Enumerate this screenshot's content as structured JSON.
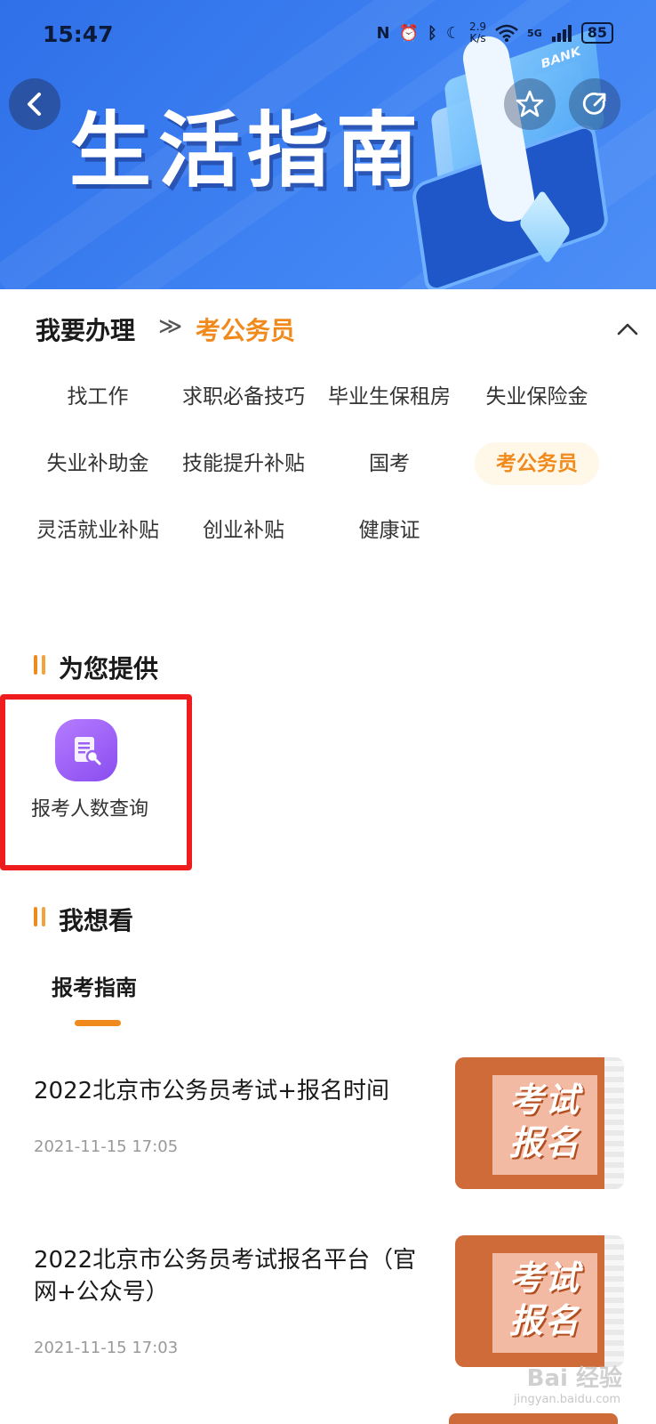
{
  "status_bar": {
    "time": "15:47",
    "net_speed_value": "2.9",
    "net_speed_unit": "K/s",
    "network": "5G",
    "battery": "85"
  },
  "banner": {
    "title": "生活指南",
    "card_text": "BANK"
  },
  "handle": {
    "title": "我要办理",
    "separator": "≫",
    "current": "考公务员",
    "chips": [
      {
        "label": "找工作"
      },
      {
        "label": "求职必备技巧"
      },
      {
        "label": "毕业生保租房"
      },
      {
        "label": "失业保险金"
      },
      {
        "label": "失业补助金"
      },
      {
        "label": "技能提升补贴"
      },
      {
        "label": "国考"
      },
      {
        "label": "考公务员"
      },
      {
        "label": "灵活就业补贴"
      },
      {
        "label": "创业补贴"
      },
      {
        "label": "健康证"
      }
    ],
    "active_chip": "考公务员"
  },
  "provide": {
    "title": "为您提供",
    "services": [
      {
        "label": "报考人数查询",
        "icon": "document-search-icon"
      }
    ]
  },
  "watch": {
    "title": "我想看",
    "tab": "报考指南",
    "articles": [
      {
        "title": "2022北京市公务员考试+报名时间",
        "time": "2021-11-15 17:05",
        "thumb_text_1": "考试",
        "thumb_text_2": "报名"
      },
      {
        "title": "2022北京市公务员考试报名平台（官网+公众号）",
        "time": "2021-11-15 17:03",
        "thumb_text_1": "考试",
        "thumb_text_2": "报名"
      }
    ]
  },
  "watermark": {
    "text": "Bai 经验",
    "sub": "jingyan.baidu.com"
  },
  "colors": {
    "accent": "#f08a1c",
    "banner": "#3e82f3",
    "highlight_border": "#ee1c1c"
  }
}
